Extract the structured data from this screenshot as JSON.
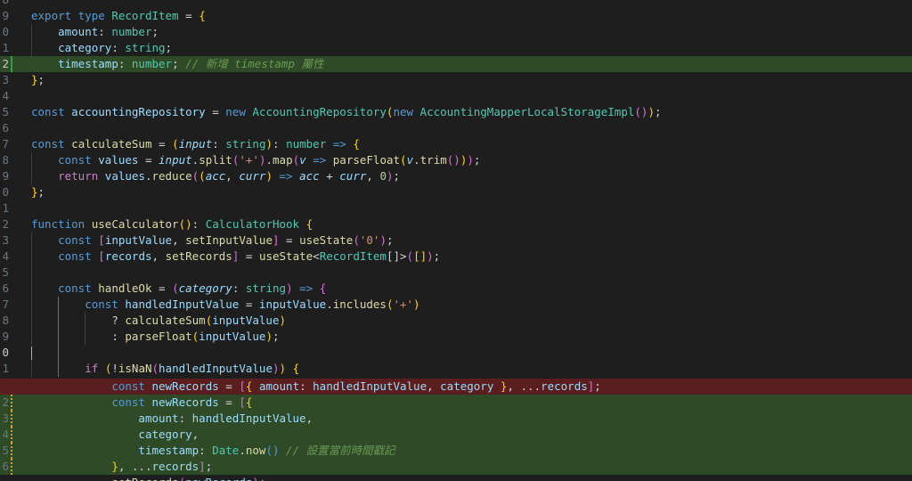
{
  "editor": {
    "language": "TypeScript",
    "theme": {
      "background": "#1e1e1e",
      "added_line_bg": "#2f4a26",
      "removed_line_bg": "#5a1e1e",
      "modified_gutter": "#2ea043"
    },
    "lines": [
      {
        "ln": "8",
        "text": ""
      },
      {
        "ln": "9",
        "text": "export type RecordItem = {"
      },
      {
        "ln": "0",
        "text": "    amount: number;"
      },
      {
        "ln": "1",
        "text": "    category: string;"
      },
      {
        "ln": "2",
        "text": "    timestamp: number; // 新增 timestamp 屬性"
      },
      {
        "ln": "3",
        "text": "};"
      },
      {
        "ln": "4",
        "text": ""
      },
      {
        "ln": "5",
        "text": "const accountingRepository = new AccountingRepository(new AccountingMapperLocalStorageImpl());"
      },
      {
        "ln": "6",
        "text": ""
      },
      {
        "ln": "7",
        "text": "const calculateSum = (input: string): number => {"
      },
      {
        "ln": "8",
        "text": "    const values = input.split('+').map(v => parseFloat(v.trim()));"
      },
      {
        "ln": "9",
        "text": "    return values.reduce((acc, curr) => acc + curr, 0);"
      },
      {
        "ln": "0",
        "text": "};"
      },
      {
        "ln": "1",
        "text": ""
      },
      {
        "ln": "2",
        "text": "function useCalculator(): CalculatorHook {"
      },
      {
        "ln": "3",
        "text": "    const [inputValue, setInputValue] = useState('0');"
      },
      {
        "ln": "4",
        "text": "    const [records, setRecords] = useState<RecordItem[]>([]);"
      },
      {
        "ln": "5",
        "text": ""
      },
      {
        "ln": "6",
        "text": "    const handleOk = (category: string) => {"
      },
      {
        "ln": "7",
        "text": "        const handledInputValue = inputValue.includes('+')"
      },
      {
        "ln": "8",
        "text": "            ? calculateSum(inputValue)"
      },
      {
        "ln": "9",
        "text": "            : parseFloat(inputValue);"
      },
      {
        "ln": "0",
        "text": ""
      },
      {
        "ln": "1",
        "text": "        if (!isNaN(handledInputValue)) {"
      },
      {
        "ln": "",
        "text": "            const newRecords = [{ amount: handledInputValue, category }, ...records];"
      },
      {
        "ln": "2",
        "text": "            const newRecords = [{"
      },
      {
        "ln": "3",
        "text": "                amount: handledInputValue,"
      },
      {
        "ln": "4",
        "text": "                category,"
      },
      {
        "ln": "5",
        "text": "                timestamp: Date.now() // 設置當前時間戳記"
      },
      {
        "ln": "6",
        "text": "            }, ...records];"
      },
      {
        "ln": "",
        "text": "            setRecords(newRecords);"
      }
    ]
  }
}
